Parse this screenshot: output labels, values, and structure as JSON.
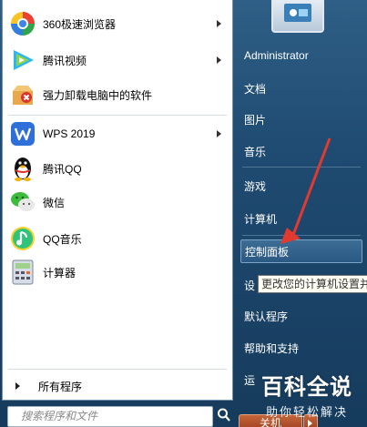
{
  "programs": [
    {
      "label": "360极速浏览器",
      "icon": "360-browser-icon",
      "has_arrow": true
    },
    {
      "label": "腾讯视频",
      "icon": "tencent-video-icon",
      "has_arrow": true
    },
    {
      "label": "强力卸载电脑中的软件",
      "icon": "uninstall-box-icon",
      "has_arrow": false
    },
    {
      "label": "WPS 2019",
      "icon": "wps-icon",
      "has_arrow": true
    },
    {
      "label": "腾讯QQ",
      "icon": "qq-penguin-icon",
      "has_arrow": false
    },
    {
      "label": "微信",
      "icon": "wechat-icon",
      "has_arrow": false
    },
    {
      "label": "QQ音乐",
      "icon": "qq-music-icon",
      "has_arrow": false
    },
    {
      "label": "计算器",
      "icon": "calculator-icon",
      "has_arrow": false
    }
  ],
  "all_programs_label": "所有程序",
  "search_placeholder": "搜索程序和文件",
  "right_items": [
    {
      "label": "Administrator"
    },
    {
      "label": "文档"
    },
    {
      "label": "图片"
    },
    {
      "label": "音乐"
    },
    {
      "label": "游戏"
    },
    {
      "label": "计算机"
    },
    {
      "label": "控制面板",
      "highlighted": true
    },
    {
      "label": "设"
    },
    {
      "label": "默认程序"
    },
    {
      "label": "帮助和支持"
    },
    {
      "label": "运"
    }
  ],
  "tooltip": "更改您的计算机设置并",
  "shutdown_label": "关机",
  "watermark": {
    "title": "百科全说",
    "subtitle": "助你轻松解决"
  },
  "colors": {
    "accent_red": "#e23a2e",
    "menu_blue": "#1f4b72"
  }
}
